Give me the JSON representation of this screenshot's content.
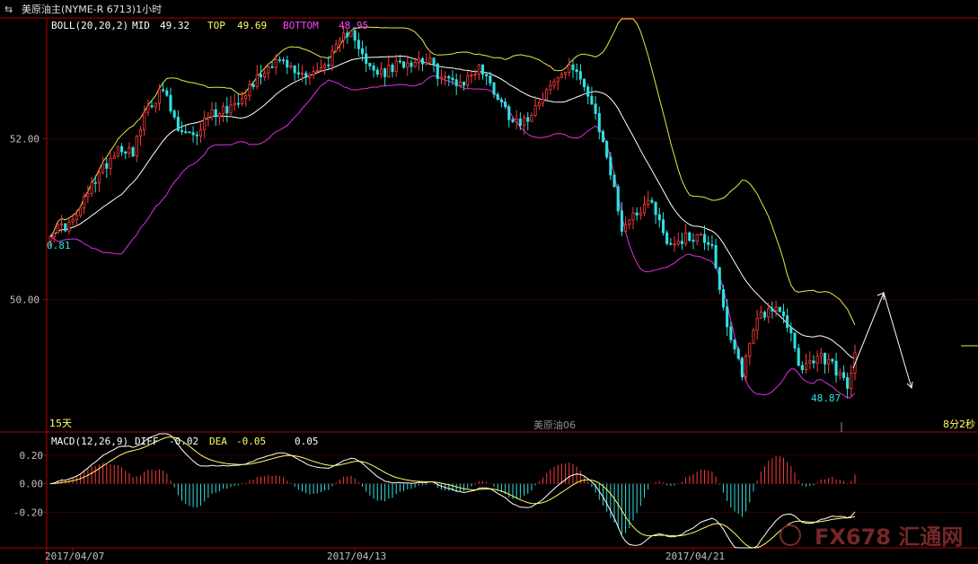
{
  "header": {
    "icon": "swap-arrows-icon",
    "title": "美原油主(NYME-R 6713)1小时"
  },
  "boll": {
    "label": "BOLL(20,20,2)",
    "mid_label": "MID",
    "mid_value": "49.32",
    "top_label": "TOP",
    "top_value": "49.69",
    "bottom_label": "BOTTOM",
    "bottom_value": "48.95"
  },
  "macd": {
    "label": "MACD(12,26,9)",
    "diff_label": "DIFF",
    "diff_value": "-0.02",
    "dea_label": "DEA",
    "dea_value": "-0.05",
    "macd_value": "0.05"
  },
  "footer": {
    "left_label": "15天",
    "center_label": "美原油06",
    "right_label": "8分2秒"
  },
  "annotations": {
    "low_left": "0.81",
    "low_right": "48.87"
  },
  "watermark": "FX678 汇通网",
  "colors": {
    "up": "#ff3c3c",
    "down": "#30e0e0",
    "mid": "#ffffff",
    "top": "#e8e840",
    "bottom": "#e030e0",
    "grid": "#8b0000",
    "axis": "#b00000",
    "text_label": "#ffffff",
    "boll_label": "#ffff66",
    "bottom_label": "#ff44ff",
    "diff": "#ffffff",
    "dea": "#ffff66",
    "hist_up": "#ff3c3c",
    "hist_down": "#30e0e0",
    "tick_text": "#c0c0c0"
  },
  "chart_data": [
    {
      "type": "candlestick",
      "title": "美原油主(NYME-R 6713)1小时",
      "x_ticks": [
        "2017/04/07",
        "2017/04/13",
        "2017/04/21"
      ],
      "y_ticks": [
        50.0,
        52.0
      ],
      "y_range": [
        48.4,
        53.5
      ],
      "grid": true,
      "bars": 215,
      "anchors": [
        {
          "i": 0,
          "v": 50.85
        },
        {
          "i": 6,
          "v": 50.95
        },
        {
          "i": 12,
          "v": 51.5
        },
        {
          "i": 18,
          "v": 51.9
        },
        {
          "i": 22,
          "v": 51.85
        },
        {
          "i": 26,
          "v": 52.4
        },
        {
          "i": 30,
          "v": 52.6
        },
        {
          "i": 34,
          "v": 52.1
        },
        {
          "i": 38,
          "v": 52.0
        },
        {
          "i": 42,
          "v": 52.3
        },
        {
          "i": 48,
          "v": 52.4
        },
        {
          "i": 54,
          "v": 52.7
        },
        {
          "i": 60,
          "v": 53.0
        },
        {
          "i": 66,
          "v": 52.8
        },
        {
          "i": 72,
          "v": 52.85
        },
        {
          "i": 76,
          "v": 53.1
        },
        {
          "i": 80,
          "v": 53.4
        },
        {
          "i": 84,
          "v": 52.9
        },
        {
          "i": 88,
          "v": 52.8
        },
        {
          "i": 94,
          "v": 52.95
        },
        {
          "i": 100,
          "v": 53.0
        },
        {
          "i": 104,
          "v": 52.75
        },
        {
          "i": 110,
          "v": 52.7
        },
        {
          "i": 114,
          "v": 52.9
        },
        {
          "i": 118,
          "v": 52.6
        },
        {
          "i": 122,
          "v": 52.3
        },
        {
          "i": 126,
          "v": 52.2
        },
        {
          "i": 130,
          "v": 52.5
        },
        {
          "i": 136,
          "v": 52.8
        },
        {
          "i": 140,
          "v": 52.9
        },
        {
          "i": 144,
          "v": 52.4
        },
        {
          "i": 148,
          "v": 51.8
        },
        {
          "i": 152,
          "v": 50.9
        },
        {
          "i": 156,
          "v": 51.1
        },
        {
          "i": 160,
          "v": 51.25
        },
        {
          "i": 164,
          "v": 50.7
        },
        {
          "i": 168,
          "v": 50.75
        },
        {
          "i": 172,
          "v": 50.8
        },
        {
          "i": 176,
          "v": 50.7
        },
        {
          "i": 180,
          "v": 49.6
        },
        {
          "i": 184,
          "v": 49.1
        },
        {
          "i": 188,
          "v": 49.8
        },
        {
          "i": 192,
          "v": 49.9
        },
        {
          "i": 196,
          "v": 49.7
        },
        {
          "i": 200,
          "v": 49.1
        },
        {
          "i": 204,
          "v": 49.3
        },
        {
          "i": 208,
          "v": 49.2
        },
        {
          "i": 212,
          "v": 48.9
        },
        {
          "i": 214,
          "v": 49.3
        }
      ],
      "series": [
        {
          "name": "MID",
          "last": 49.32
        },
        {
          "name": "TOP",
          "last": 49.69
        },
        {
          "name": "BOTTOM",
          "last": 48.95
        }
      ]
    },
    {
      "type": "bar",
      "title": "MACD(12,26,9)",
      "y_ticks": [
        0.2,
        0.0,
        -0.2
      ],
      "y_range": [
        -0.45,
        0.35
      ],
      "grid": true,
      "series": [
        {
          "name": "DIFF",
          "last": -0.02
        },
        {
          "name": "DEA",
          "last": -0.05
        }
      ]
    }
  ]
}
